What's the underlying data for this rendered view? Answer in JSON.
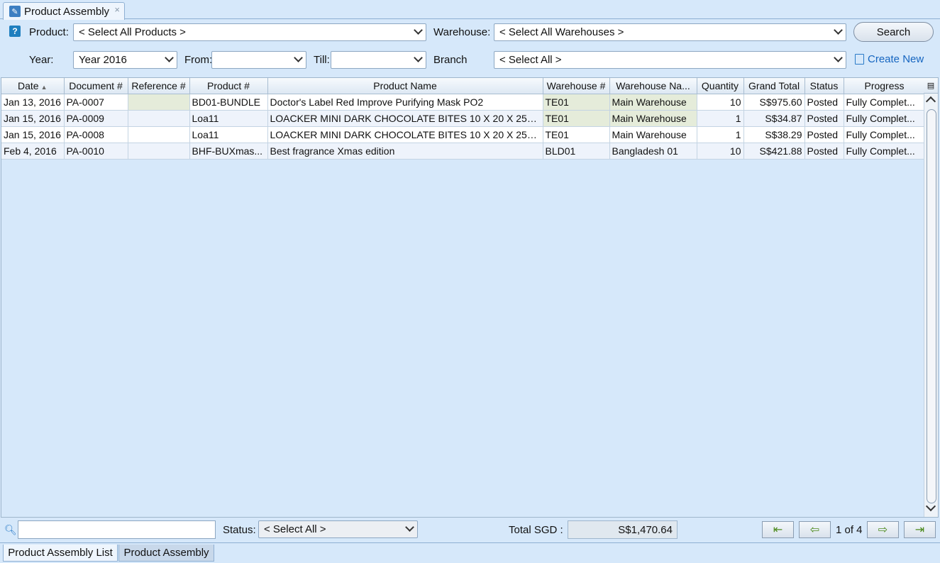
{
  "window": {
    "tab_label": "Product Assembly",
    "close_glyph": "×"
  },
  "filters": {
    "product_label": "Product:",
    "product_value": "< Select All Products >",
    "warehouse_label": "Warehouse:",
    "warehouse_value": "< Select All Warehouses >",
    "search_label": "Search",
    "year_label": "Year:",
    "year_value": "Year 2016",
    "from_label": "From:",
    "from_value": "",
    "till_label": "Till:",
    "till_value": "",
    "branch_label": "Branch",
    "branch_value": "< Select All >",
    "create_new_label": "Create New"
  },
  "grid": {
    "columns": [
      "Date",
      "Document #",
      "Reference #",
      "Product #",
      "Product Name",
      "Warehouse #",
      "Warehouse Na...",
      "Quantity",
      "Grand Total",
      "Status",
      "Progress"
    ],
    "sort_column": "Date",
    "sort_direction": "ascending",
    "rows": [
      {
        "date": "Jan 13, 2016",
        "document": "PA-0007",
        "reference": "",
        "product": "BD01-BUNDLE",
        "product_name": "Doctor's Label Red Improve Purifying Mask PO2",
        "warehouse": "TE01",
        "warehouse_name": "Main Warehouse",
        "quantity": "10",
        "grand_total": "S$975.60",
        "status": "Posted",
        "progress": "Fully Complet..."
      },
      {
        "date": "Jan 15, 2016",
        "document": "PA-0009",
        "reference": "",
        "product": "Loa11",
        "product_name": "LOACKER MINI DARK CHOCOLATE BITES 10 X 20 X 25G...",
        "warehouse": "TE01",
        "warehouse_name": "Main Warehouse",
        "quantity": "1",
        "grand_total": "S$34.87",
        "status": "Posted",
        "progress": "Fully Complet..."
      },
      {
        "date": "Jan 15, 2016",
        "document": "PA-0008",
        "reference": "",
        "product": "Loa11",
        "product_name": "LOACKER MINI DARK CHOCOLATE BITES 10 X 20 X 25G...",
        "warehouse": "TE01",
        "warehouse_name": "Main Warehouse",
        "quantity": "1",
        "grand_total": "S$38.29",
        "status": "Posted",
        "progress": "Fully Complet..."
      },
      {
        "date": "Feb 4, 2016",
        "document": "PA-0010",
        "reference": "",
        "product": "BHF-BUXmas...",
        "product_name": "Best fragrance Xmas edition",
        "warehouse": "BLD01",
        "warehouse_name": "Bangladesh 01",
        "quantity": "10",
        "grand_total": "S$421.88",
        "status": "Posted",
        "progress": "Fully Complet..."
      }
    ]
  },
  "footer": {
    "find_value": "",
    "status_label": "Status:",
    "status_value": "< Select All >",
    "total_label": "Total SGD :",
    "total_value": "S$1,470.64",
    "page_text": "1 of 4"
  },
  "view_tabs": [
    "Product Assembly List",
    "Product Assembly"
  ],
  "colors": {
    "background": "#d6e8fa",
    "link": "#1565c0",
    "highlight_cell": "#e5ecda",
    "nav_arrow": "#4c8a1c"
  }
}
